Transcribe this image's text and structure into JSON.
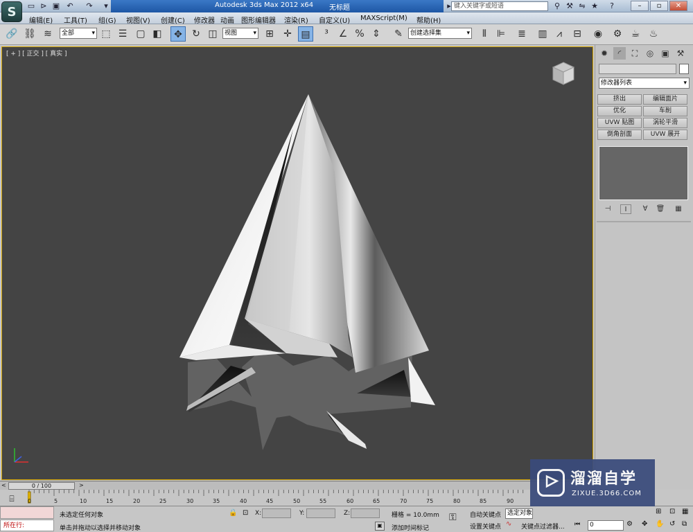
{
  "titlebar": {
    "app_title": "Autodesk 3ds Max  2012 x64",
    "document": "无标题",
    "search_placeholder": "键入关键字或短语",
    "logo": "S"
  },
  "menus": [
    "编辑(E)",
    "工具(T)",
    "组(G)",
    "视图(V)",
    "创建(C)",
    "修改器",
    "动画",
    "图形编辑器",
    "渲染(R)",
    "自定义(U)",
    "MAXScript(M)",
    "帮助(H)"
  ],
  "toolbar": {
    "selection_filter": "全部",
    "ref_coord": "视图",
    "named_selection": "创建选择集"
  },
  "viewport": {
    "label": "[ + ] [ 正交 ] [ 真实 ]",
    "background": "#444444",
    "active_border": "#d5a500"
  },
  "command_panel": {
    "modifier_list": "修改器列表",
    "modifier_buttons": [
      "挤出",
      "编辑面片",
      "优化",
      "车削",
      "UVW 贴图",
      "涡轮平滑",
      "倒角剖面",
      "UVW 展开"
    ]
  },
  "timeline": {
    "frame_display": "0 / 100",
    "ticks": [
      "0",
      "5",
      "10",
      "15",
      "20",
      "25",
      "30",
      "35",
      "40",
      "45",
      "50",
      "55",
      "60",
      "65",
      "70",
      "75",
      "80",
      "85",
      "90"
    ],
    "current_frame": 0,
    "total_frames": 100
  },
  "status": {
    "running_label": "所在行:",
    "selection_message": "未选定任何对象",
    "prompt": "单击并拖动以选择并移动对象",
    "x_label": "X:",
    "y_label": "Y:",
    "z_label": "Z:",
    "grid": "栅格 = 10.0mm",
    "add_time_tag": "添加时间标记",
    "auto_key": "自动关键点",
    "set_key": "设置关键点",
    "selected_dropdown": "选定对象",
    "key_filters": "关键点过滤器...",
    "frame_input": "0"
  },
  "watermark": {
    "title": "溜溜自学",
    "url": "ZIXUE.3D66.COM"
  }
}
